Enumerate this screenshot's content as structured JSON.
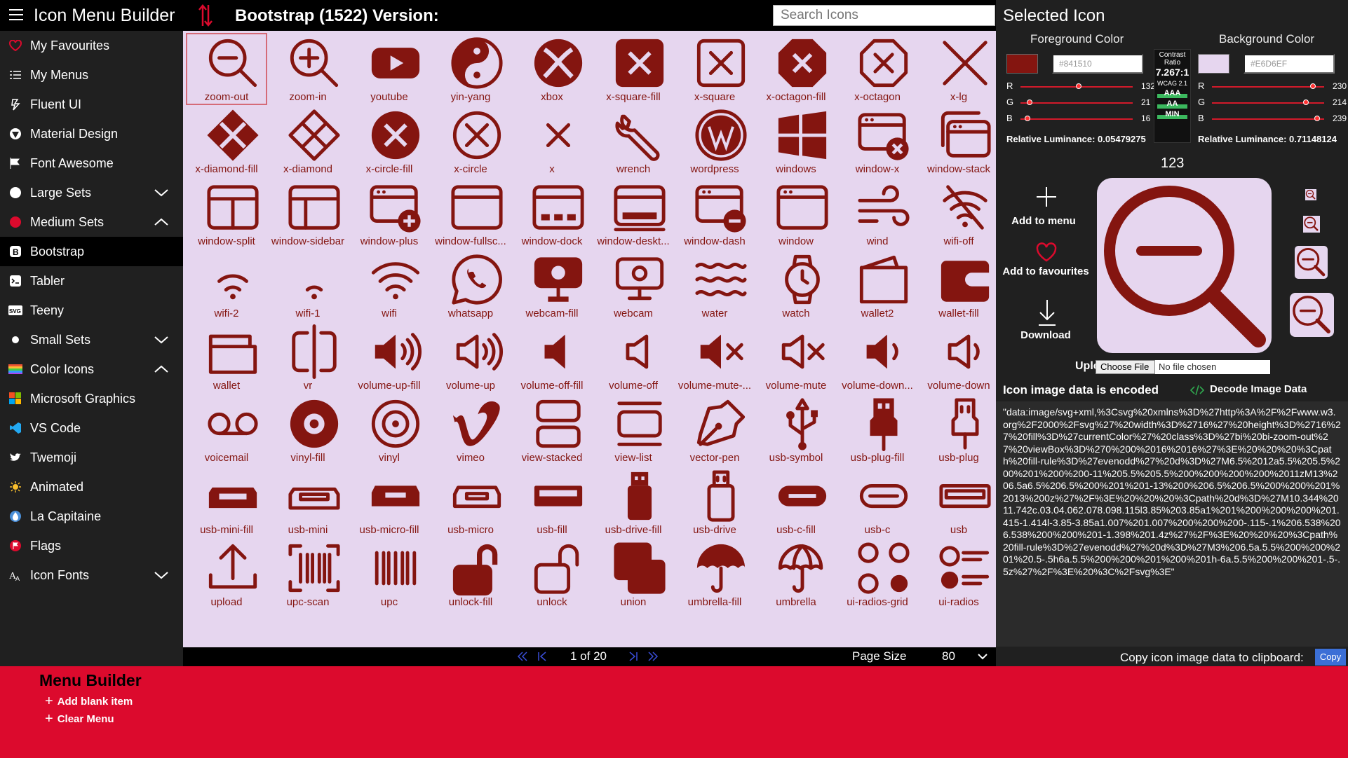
{
  "app": {
    "title": "Icon Menu Builder",
    "heading": "Bootstrap (1522) Version:",
    "search_placeholder": "Search Icons"
  },
  "colors": {
    "foreground": "#841510",
    "background": "#E6D6EF",
    "accent": "#dc0a2d"
  },
  "sidebar": {
    "items": [
      {
        "label": "My Favourites",
        "icon": "heart-icon"
      },
      {
        "label": "My Menus",
        "icon": "list-icon"
      },
      {
        "label": "Fluent UI",
        "icon": "fluent-icon"
      },
      {
        "label": "Material Design",
        "icon": "material-icon"
      },
      {
        "label": "Font Awesome",
        "icon": "flag-icon"
      },
      {
        "label": "Large Sets",
        "icon": "circle-icon",
        "chevron": "down"
      },
      {
        "label": "Medium Sets",
        "icon": "red-circle-icon",
        "chevron": "up"
      },
      {
        "label": "Bootstrap",
        "icon": "bootstrap-icon",
        "active": true
      },
      {
        "label": "Tabler",
        "icon": "terminal-icon"
      },
      {
        "label": "Teeny",
        "icon": "svg-icon"
      },
      {
        "label": "Small Sets",
        "icon": "dot-icon",
        "chevron": "down"
      },
      {
        "label": "Color Icons",
        "icon": "rainbow-icon",
        "chevron": "up"
      },
      {
        "label": "Microsoft Graphics",
        "icon": "windows-logo-icon"
      },
      {
        "label": "VS Code",
        "icon": "vscode-icon"
      },
      {
        "label": "Twemoji",
        "icon": "bird-icon"
      },
      {
        "label": "Animated",
        "icon": "sun-icon"
      },
      {
        "label": "La Capitaine",
        "icon": "drop-icon"
      },
      {
        "label": "Flags",
        "icon": "flag-circle-icon"
      },
      {
        "label": "Icon Fonts",
        "icon": "font-icon",
        "chevron": "down"
      }
    ]
  },
  "icons": [
    "zoom-out",
    "zoom-in",
    "youtube",
    "yin-yang",
    "xbox",
    "x-square-fill",
    "x-square",
    "x-octagon-fill",
    "x-octagon",
    "x-lg",
    "x-diamond-fill",
    "x-diamond",
    "x-circle-fill",
    "x-circle",
    "x",
    "wrench",
    "wordpress",
    "windows",
    "window-x",
    "window-stack",
    "window-split",
    "window-sidebar",
    "window-plus",
    "window-fullsc...",
    "window-dock",
    "window-deskt...",
    "window-dash",
    "window",
    "wind",
    "wifi-off",
    "wifi-2",
    "wifi-1",
    "wifi",
    "whatsapp",
    "webcam-fill",
    "webcam",
    "water",
    "watch",
    "wallet2",
    "wallet-fill",
    "wallet",
    "vr",
    "volume-up-fill",
    "volume-up",
    "volume-off-fill",
    "volume-off",
    "volume-mute-...",
    "volume-mute",
    "volume-down...",
    "volume-down",
    "voicemail",
    "vinyl-fill",
    "vinyl",
    "vimeo",
    "view-stacked",
    "view-list",
    "vector-pen",
    "usb-symbol",
    "usb-plug-fill",
    "usb-plug",
    "usb-mini-fill",
    "usb-mini",
    "usb-micro-fill",
    "usb-micro",
    "usb-fill",
    "usb-drive-fill",
    "usb-drive",
    "usb-c-fill",
    "usb-c",
    "usb",
    "upload",
    "upc-scan",
    "upc",
    "unlock-fill",
    "unlock",
    "union",
    "umbrella-fill",
    "umbrella",
    "ui-radios-grid",
    "ui-radios"
  ],
  "selected_index": 0,
  "pager": {
    "page": "1 of 20",
    "page_size_label": "Page Size",
    "page_size": "80"
  },
  "panel": {
    "title": "Selected Icon",
    "fg_label": "Foreground Color",
    "bg_label": "Background Color",
    "fg_hex": "#841510",
    "bg_hex": "#E6D6EF",
    "fg_rgb": {
      "r": "132",
      "g": "21",
      "b": "16"
    },
    "bg_rgb": {
      "r": "230",
      "g": "214",
      "b": "239"
    },
    "fg_rgb_levels": [
      132,
      21,
      16
    ],
    "bg_rgb_levels": [
      230,
      214,
      239
    ],
    "channel_labels": [
      "R",
      "G",
      "B"
    ],
    "fg_lum": "Relative Luminance: 0.05479275",
    "bg_lum": "Relative Luminance: 0.71148124",
    "contrast_label": "Contrast Ratio",
    "contrast": "7.267:1",
    "wcag": "WCAG 2.1",
    "levels": [
      "AAA",
      "AA",
      "MIN"
    ],
    "size_value": "123",
    "add_menu": "Add to menu",
    "add_fav": "Add to favourites",
    "download": "Download",
    "upload_label": "Upload:",
    "choose_file": "Choose File",
    "no_file": "No file chosen",
    "encoded_label": "Icon image data is encoded",
    "decode_label": "Decode Image Data",
    "data_text": "\"data:image/svg+xml,%3Csvg%20xmlns%3D%27http%3A%2F%2Fwww.w3.org%2F2000%2Fsvg%27%20width%3D%2716%27%20height%3D%2716%27%20fill%3D%27currentColor%27%20class%3D%27bi%20bi-zoom-out%27%20viewBox%3D%270%200%2016%2016%27%3E%20%20%20%3Cpath%20fill-rule%3D%27evenodd%27%20d%3D%27M6.5%2012a5.5%205.5%200%201%200%200-11%205.5%205.5%200%200%200%200%2011zM13%206.5a6.5%206.5%200%201%201-13%200%206.5%206.5%200%200%201%2013%200z%27%2F%3E%20%20%20%3Cpath%20d%3D%27M10.344%2011.742c.03.04.062.078.098.115l3.85%203.85a1%201%200%200%200%201.415-1.414l-3.85-3.85a1.007%201.007%200%200%200-.115-.1%206.538%206.538%200%200%201-1.398%201.4z%27%2F%3E%20%20%20%3Cpath%20fill-rule%3D%27evenodd%27%20d%3D%27M3%206.5a.5.5%200%200%201%20.5-.5h6a.5.5%200%200%201%200%201h-6a.5.5%200%200%201-.5-.5z%27%2F%3E%20%3C%2Fsvg%3E\"",
    "copy_label": "Copy icon image data to clipboard:",
    "copy_btn": "Copy"
  },
  "builder": {
    "title": "Menu Builder",
    "add_blank": "Add blank item",
    "clear": "Clear Menu"
  }
}
